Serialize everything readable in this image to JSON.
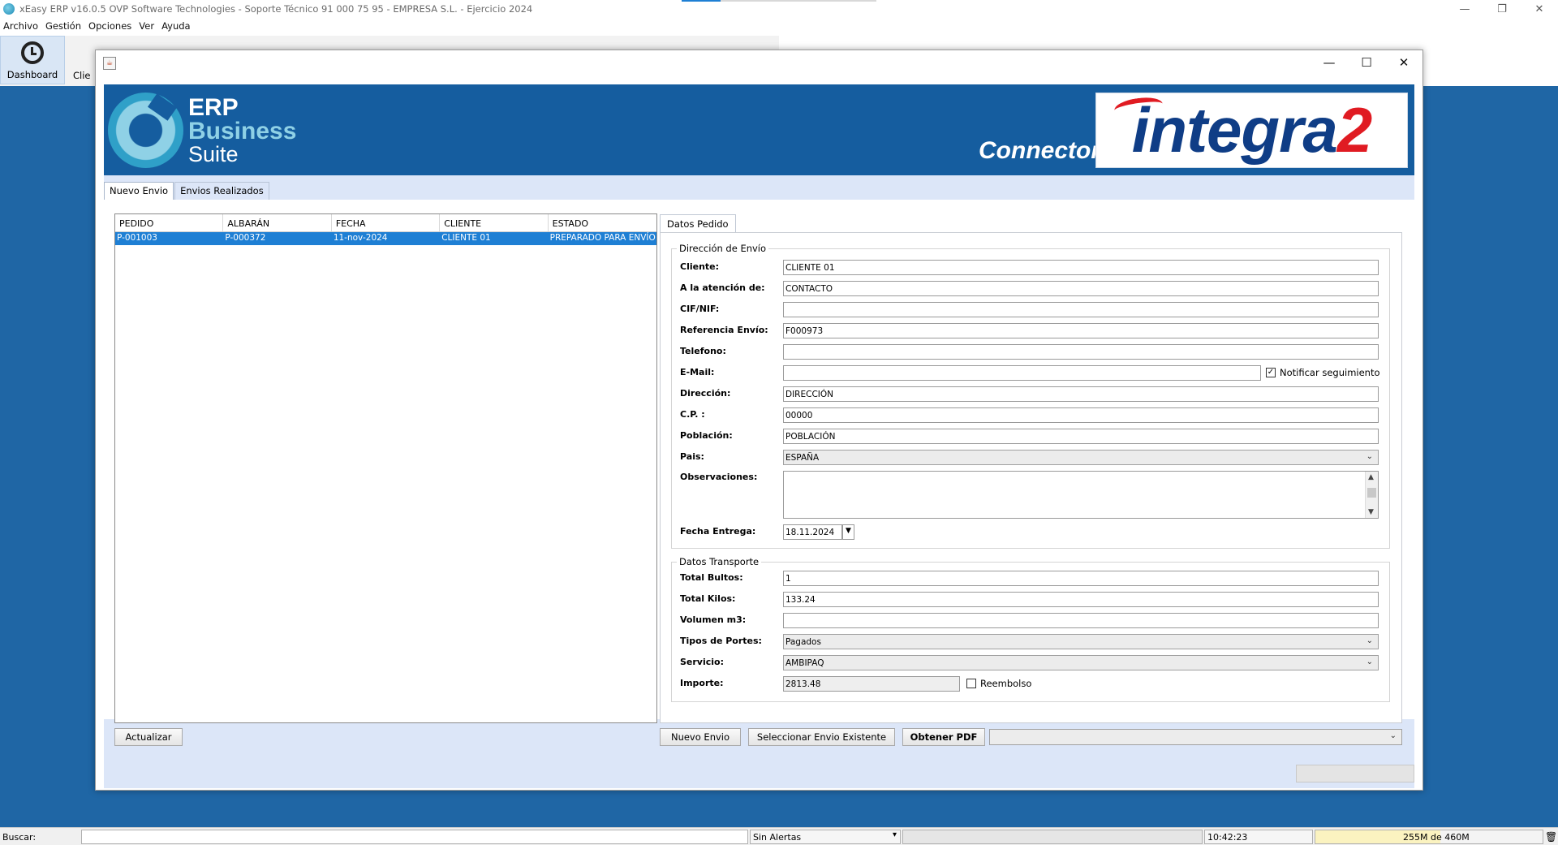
{
  "app": {
    "title": "xEasy ERP v16.0.5 OVP Software Technologies - Soporte Técnico 91 000 75 95 - EMPRESA S.L. - Ejercicio 2024",
    "window_controls": [
      "—",
      "❐",
      "✕"
    ]
  },
  "menu": [
    "Archivo",
    "Gestión",
    "Opciones",
    "Ver",
    "Ayuda"
  ],
  "toolbar": {
    "dashboard_label": "Dashboard",
    "clientes_partial": "Clie"
  },
  "dialog": {
    "controls": [
      "—",
      "☐",
      "✕"
    ],
    "banner": {
      "erp_line1": "ERP",
      "erp_line2": "Business",
      "erp_line3": "Suite",
      "connector": "Connector",
      "integra_main": "integra",
      "integra_two": "2"
    },
    "tabs": [
      "Nuevo Envio",
      "Envios Realizados"
    ],
    "table": {
      "headers": [
        "PEDIDO",
        "ALBARÁN",
        "FECHA",
        "CLIENTE",
        "ESTADO"
      ],
      "rows": [
        [
          "P-001003",
          "P-000372",
          "11-nov-2024",
          "CLIENTE 01",
          "PREPARADO PARA ENVÍO"
        ]
      ]
    },
    "right_tab": "Datos Pedido",
    "direccion": {
      "title": "Dirección de Envío",
      "cliente_label": "Cliente:",
      "cliente": "CLIENTE 01",
      "atencion_label": "A la atención de:",
      "atencion": "CONTACTO",
      "cif_label": "CIF/NIF:",
      "cif": "",
      "ref_label": "Referencia Envío:",
      "ref": "F000973",
      "tel_label": "Telefono:",
      "tel": "",
      "email_label": "E-Mail:",
      "email": "",
      "notificar_label": "Notificar seguimiento",
      "dir_label": "Dirección:",
      "dir": "DIRECCIÓN",
      "cp_label": "C.P. :",
      "cp": "00000",
      "pob_label": "Población:",
      "pob": "POBLACIÓN",
      "pais_label": "Pais:",
      "pais": "ESPAÑA",
      "obs_label": "Observaciones:",
      "fecha_label": "Fecha Entrega:",
      "fecha": "18.11.2024"
    },
    "transporte": {
      "title": "Datos Transporte",
      "bultos_label": "Total Bultos:",
      "bultos": "1",
      "kilos_label": "Total Kilos:",
      "kilos": "133.24",
      "vol_label": "Volumen m3:",
      "vol": "",
      "portes_label": "Tipos de Portes:",
      "portes": "Pagados",
      "servicio_label": "Servicio:",
      "servicio": "AMBIPAQ",
      "importe_label": "Importe:",
      "importe": "2813.48",
      "reembolso_label": "Reembolso"
    },
    "buttons": {
      "actualizar": "Actualizar",
      "nuevo_envio": "Nuevo Envio",
      "seleccionar": "Seleccionar Envio Existente",
      "obtener_pdf": "Obtener PDF"
    }
  },
  "status": {
    "buscar_label": "Buscar:",
    "alertas": "Sin Alertas",
    "time": "10:42:23",
    "memory": "255M de 460M"
  }
}
